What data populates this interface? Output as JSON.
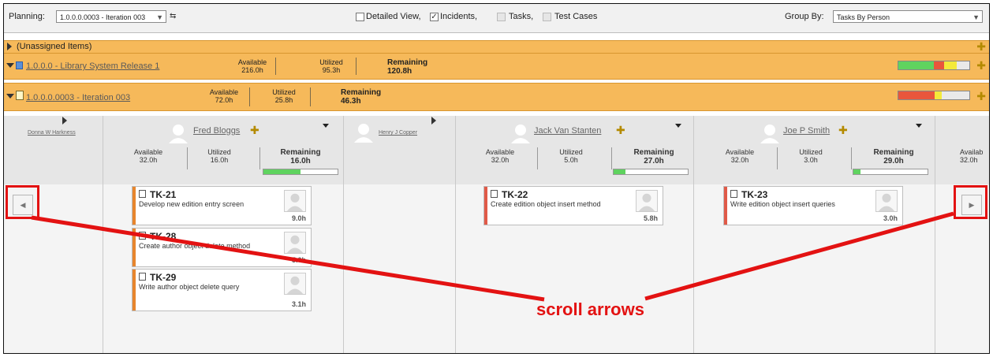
{
  "toolbar": {
    "planning_label": "Planning:",
    "planning_value": "1.0.0.0.0003 - Iteration 003",
    "detailed_view_label": "Detailed View,",
    "incidents_label": "Incidents,",
    "tasks_label": "Tasks,",
    "test_cases_label": "Test Cases",
    "detailed_view_checked": false,
    "incidents_checked": true,
    "group_by_label": "Group By:",
    "group_by_value": "Tasks By Person"
  },
  "rows": {
    "unassigned_label": "(Unassigned Items)",
    "release": {
      "name": "1.0.0.0 - Library System Release 1",
      "available_label": "Available",
      "available": "216.0h",
      "utilized_label": "Utilized",
      "utilized": "95.3h",
      "remaining_label": "Remaining",
      "remaining": "120.8h"
    },
    "iteration": {
      "name": "1.0.0.0.0003 - Iteration 003",
      "available_label": "Available",
      "available": "72.0h",
      "utilized_label": "Utilized",
      "utilized": "25.8h",
      "remaining_label": "Remaining",
      "remaining": "46.3h"
    }
  },
  "people": [
    {
      "name": "Donna W Harkness",
      "collapsed": true
    },
    {
      "name": "Fred Bloggs",
      "available_label": "Available",
      "available": "32.0h",
      "utilized_label": "Utilized",
      "utilized": "16.0h",
      "remaining_label": "Remaining",
      "remaining": "16.0h",
      "progress": 0.5
    },
    {
      "name": "Henry J Copper",
      "collapsed": true
    },
    {
      "name": "Jack Van Stanten",
      "available_label": "Available",
      "available": "32.0h",
      "utilized_label": "Utilized",
      "utilized": "5.0h",
      "remaining_label": "Remaining",
      "remaining": "27.0h",
      "progress": 0.16
    },
    {
      "name": "Joe P Smith",
      "available_label": "Available",
      "available": "32.0h",
      "utilized_label": "Utilized",
      "utilized": "3.0h",
      "remaining_label": "Remaining",
      "remaining": "29.0h",
      "progress": 0.1
    },
    {
      "available_label": "Availab",
      "available": "32.0h"
    }
  ],
  "tasks": [
    {
      "id": "TK-21",
      "desc": "Develop new edition entry screen",
      "hours": "9.0h"
    },
    {
      "id": "TK-28",
      "desc": "Create author object delete method",
      "hours": "5.0h"
    },
    {
      "id": "TK-29",
      "desc": "Write author object delete query",
      "hours": "3.1h"
    },
    {
      "id": "TK-22",
      "desc": "Create edition object insert method",
      "hours": "5.8h"
    },
    {
      "id": "TK-23",
      "desc": "Write edition object insert queries",
      "hours": "3.0h"
    }
  ],
  "annotation": "scroll arrows",
  "colors": {
    "orange": "#f6b95a",
    "annotation_red": "#e31212",
    "green": "#5fd35f",
    "task_strip_orange": "#e7852d",
    "task_strip_red": "#e05a48"
  }
}
